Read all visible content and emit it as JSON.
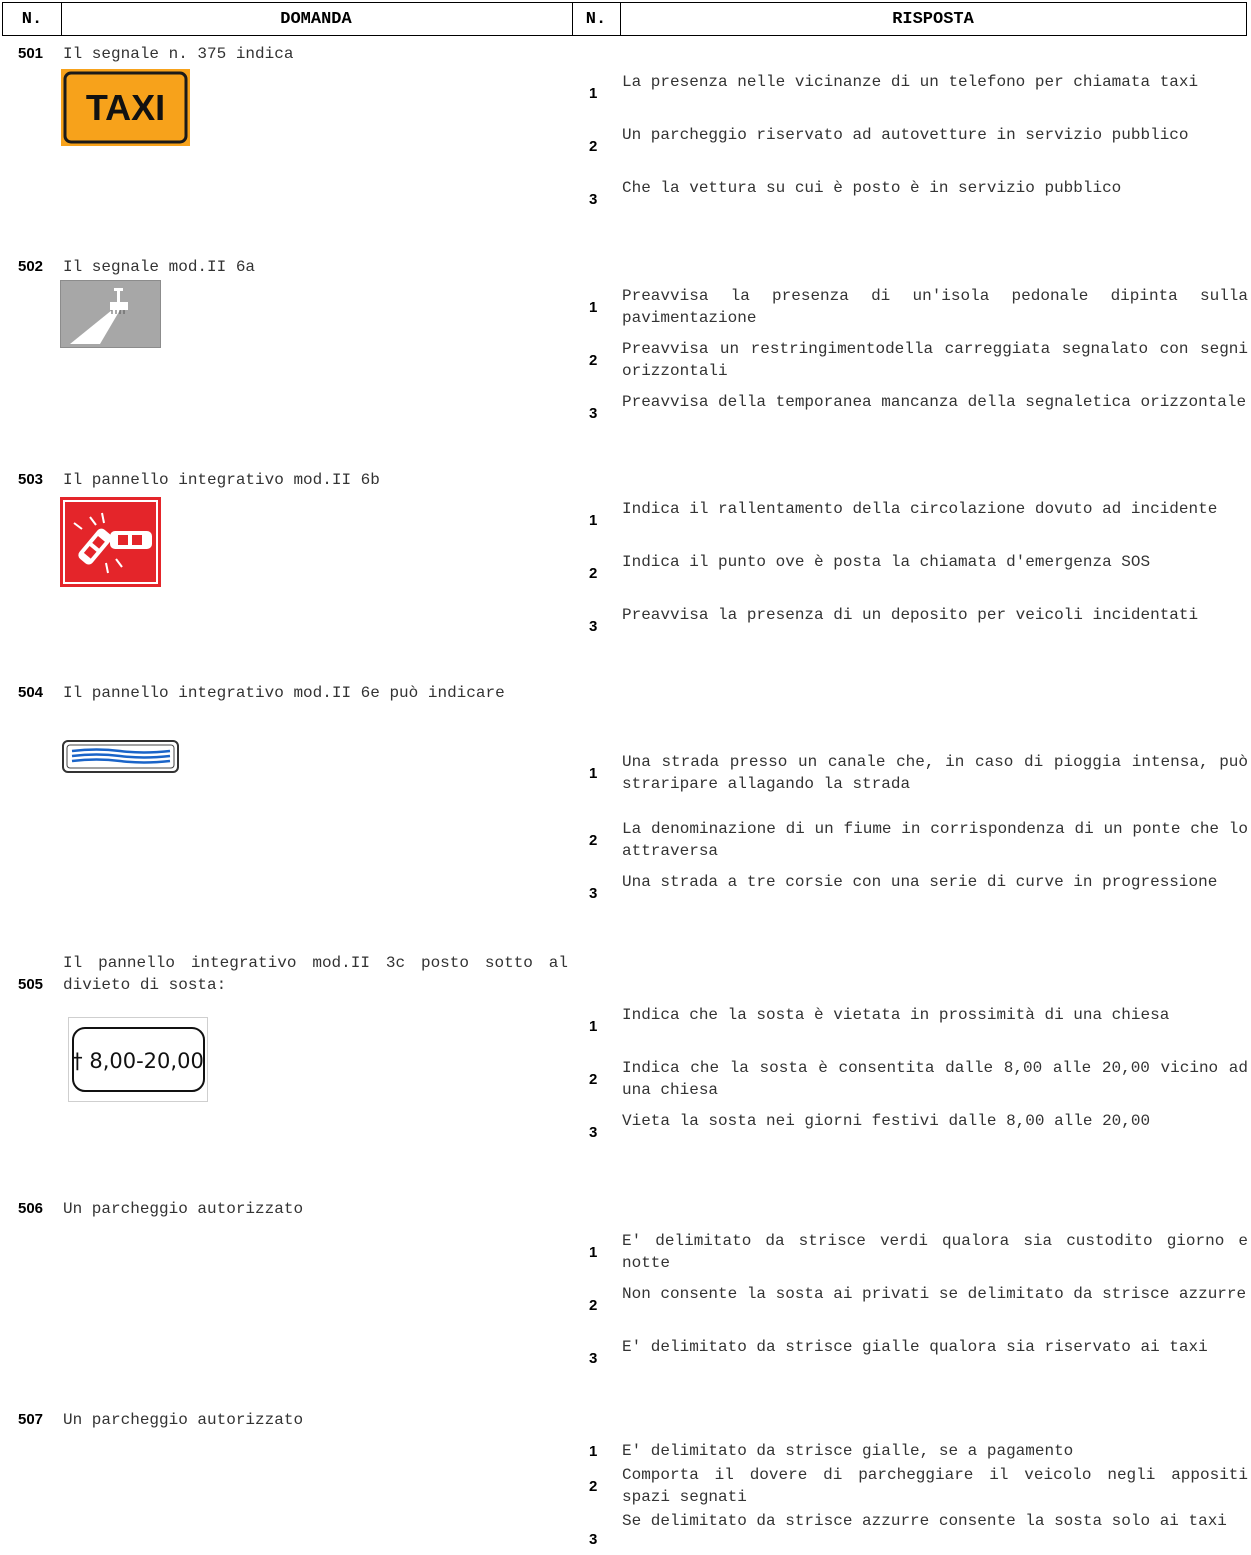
{
  "header": {
    "n1": "N.",
    "domanda": "DOMANDA",
    "n2": "N.",
    "risposta": "RISPOSTA"
  },
  "questions": [
    {
      "num": "501",
      "text": "Il segnale n. 375 indica",
      "sign": "taxi-sign",
      "sign_text": "TAXI",
      "answers": [
        {
          "n": "1",
          "text": "La presenza nelle vicinanze di un telefono per chiamata taxi"
        },
        {
          "n": "2",
          "text": "Un parcheggio riservato ad autovetture in servizio pubblico"
        },
        {
          "n": "3",
          "text": "Che la vettura su cui è posto è in servizio pubblico"
        }
      ]
    },
    {
      "num": "502",
      "text": "Il segnale mod.II 6a",
      "sign": "road-marking-machine-sign",
      "answers": [
        {
          "n": "1",
          "text": "Preavvisa la presenza di un'isola pedonale dipinta sulla pavimentazione"
        },
        {
          "n": "2",
          "text": "Preavvisa un restringimentodella carreggiata segnalato con segni orizzontali"
        },
        {
          "n": "3",
          "text": "Preavvisa della temporanea mancanza della segnaletica orizzontale"
        }
      ]
    },
    {
      "num": "503",
      "text": "Il pannello integrativo mod.II 6b",
      "sign": "accident-panel-sign",
      "answers": [
        {
          "n": "1",
          "text": "Indica il rallentamento della circolazione dovuto ad incidente"
        },
        {
          "n": "2",
          "text": "Indica il punto ove è posta la chiamata d'emergenza SOS"
        },
        {
          "n": "3",
          "text": "Preavvisa la presenza di un deposito per veicoli incidentati"
        }
      ]
    },
    {
      "num": "504",
      "text": "Il pannello integrativo mod.II 6e può indicare",
      "sign": "water-panel-sign",
      "answers": [
        {
          "n": "1",
          "text": "Una strada presso un canale che, in caso di pioggia intensa, può straripare allagando la strada"
        },
        {
          "n": "2",
          "text": "La denominazione di un fiume in corrispondenza di un ponte che lo attraversa"
        },
        {
          "n": "3",
          "text": "Una strada a tre corsie con una serie di curve in progressione"
        }
      ]
    },
    {
      "num": "505",
      "text": "Il pannello integrativo mod.II 3c posto sotto al divieto di sosta:",
      "sign": "church-hours-panel-sign",
      "sign_text": "† 8,00-20,00",
      "answers": [
        {
          "n": "1",
          "text": "Indica che la sosta è vietata in prossimità di una chiesa"
        },
        {
          "n": "2",
          "text": "Indica che la sosta è consentita dalle 8,00 alle 20,00 vicino ad una chiesa"
        },
        {
          "n": "3",
          "text": "Vieta la sosta nei giorni festivi dalle 8,00 alle 20,00"
        }
      ]
    },
    {
      "num": "506",
      "text": "Un parcheggio autorizzato",
      "sign": "",
      "answers": [
        {
          "n": "1",
          "text": "E' delimitato da strisce verdi qualora sia custodito giorno e notte"
        },
        {
          "n": "2",
          "text": "Non consente la sosta ai privati se delimitato da strisce azzurre"
        },
        {
          "n": "3",
          "text": "E' delimitato da strisce gialle qualora sia riservato ai taxi"
        }
      ]
    },
    {
      "num": "507",
      "text": "Un parcheggio autorizzato",
      "sign": "",
      "answers": [
        {
          "n": "1",
          "text": "E' delimitato da strisce gialle, se a pagamento"
        },
        {
          "n": "2",
          "text": "Comporta il dovere di parcheggiare il veicolo negli appositi spazi segnati"
        },
        {
          "n": "3",
          "text": "Se delimitato da strisce azzurre consente la sosta solo ai taxi"
        }
      ]
    }
  ],
  "colors": {
    "taxi_bg": "#f7a21b",
    "accident_bg": "#e4252a",
    "water_blue": "#1a64c8",
    "marking_gray": "#a0a0a0"
  }
}
